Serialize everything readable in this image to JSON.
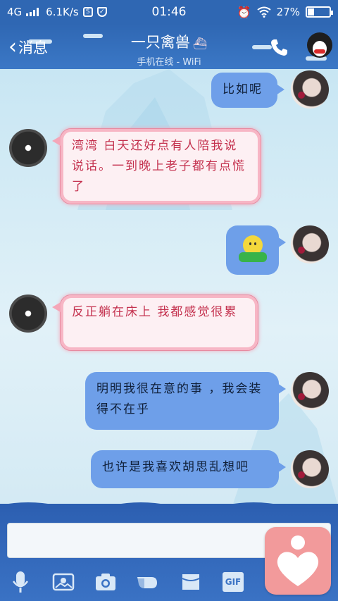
{
  "status_bar": {
    "network": "4G",
    "speed": "6.1K/s",
    "time": "01:46",
    "battery": "27%",
    "battery_level": 0.27
  },
  "header": {
    "back_label": "消息",
    "contact_name": "一只禽兽",
    "status": "手机在线 - WiFi"
  },
  "messages": [
    {
      "side": "me",
      "text": "比如呢"
    },
    {
      "side": "other",
      "text": "湾湾 白天还好点有人陪我说说话。一到晚上老子都有点慌了"
    },
    {
      "side": "me",
      "type": "emoji",
      "text": ""
    },
    {
      "side": "other",
      "text": "反正躺在床上 我都感觉很累"
    },
    {
      "side": "me",
      "text": "明明我很在意的事 ，我会装得不在乎"
    },
    {
      "side": "me",
      "text": "也许是我喜欢胡思乱想吧"
    }
  ],
  "input": {
    "placeholder": ""
  },
  "toolbar": {
    "gif_label": "GIF"
  },
  "colors": {
    "header_blue": "#2f67b3",
    "my_bubble": "#6e9fe9",
    "other_text": "#c4314e",
    "fab_pink": "#f29a9b"
  }
}
